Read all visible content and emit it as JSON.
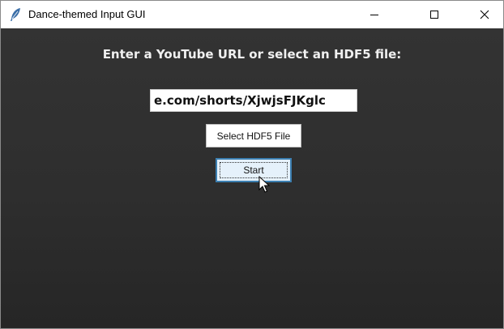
{
  "window": {
    "title": "Dance-themed Input GUI",
    "controls": {
      "minimize_icon": "minimize-icon",
      "maximize_icon": "maximize-icon",
      "close_icon": "close-icon"
    }
  },
  "main": {
    "prompt": "Enter a YouTube URL or select an HDF5 file:",
    "url_input_value": "e.com/shorts/XjwjsFJKglc",
    "select_hdf5_label": "Select HDF5 File",
    "start_label": "Start"
  },
  "colors": {
    "background": "#2e2e2e",
    "prompt_text": "#f0f0f0",
    "start_button_fill": "#e5f1fb",
    "start_button_border": "#3c7fb1"
  }
}
